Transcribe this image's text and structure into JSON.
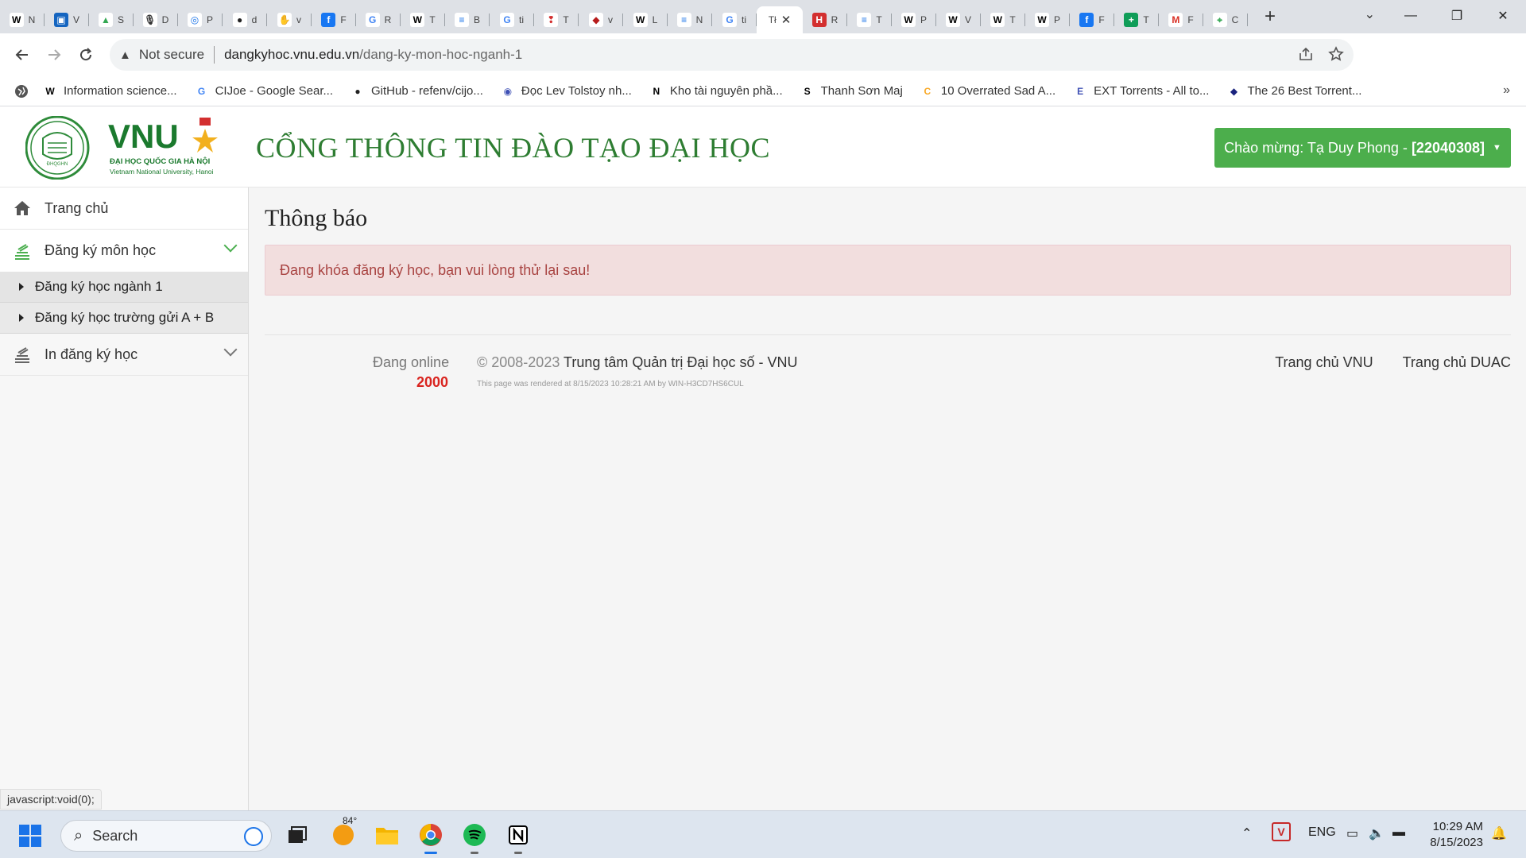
{
  "browser": {
    "tabs": [
      {
        "icon": "wikipedia-icon",
        "glyph": "W",
        "letter": "N",
        "bg": "#ffffff",
        "fg": "#000000"
      },
      {
        "icon": "blue-app-icon",
        "glyph": "▣",
        "letter": "V",
        "bg": "#1565c0",
        "fg": "#ffffff"
      },
      {
        "icon": "google-drive-icon",
        "glyph": "▲",
        "letter": "S",
        "bg": "#ffffff",
        "fg": "#34a853"
      },
      {
        "icon": "microphone-icon",
        "glyph": "🎙",
        "letter": "D",
        "bg": "#ffffff",
        "fg": "#333333"
      },
      {
        "icon": "globe-icon",
        "glyph": "◎",
        "letter": "P",
        "bg": "#ffffff",
        "fg": "#1a73e8"
      },
      {
        "icon": "dark-circle-icon",
        "glyph": "●",
        "letter": "d",
        "bg": "#ffffff",
        "fg": "#222222"
      },
      {
        "icon": "hand-icon",
        "glyph": "✋",
        "letter": "v",
        "bg": "#ffffff",
        "fg": "#e67e22"
      },
      {
        "icon": "facebook-icon",
        "glyph": "f",
        "letter": "F",
        "bg": "#1877f2",
        "fg": "#ffffff"
      },
      {
        "icon": "google-icon",
        "glyph": "G",
        "letter": "R",
        "bg": "#ffffff",
        "fg": "#4285f4"
      },
      {
        "icon": "wikipedia-icon",
        "glyph": "W",
        "letter": "T",
        "bg": "#ffffff",
        "fg": "#000000"
      },
      {
        "icon": "checklist-icon",
        "glyph": "≡",
        "letter": "B",
        "bg": "#ffffff",
        "fg": "#1a73e8"
      },
      {
        "icon": "google-icon",
        "glyph": "G",
        "letter": "ti",
        "bg": "#ffffff",
        "fg": "#4285f4"
      },
      {
        "icon": "pin-icon",
        "glyph": "❢",
        "letter": "T",
        "bg": "#ffffff",
        "fg": "#d32f2f"
      },
      {
        "icon": "diamond-icon",
        "glyph": "◆",
        "letter": "v",
        "bg": "#ffffff",
        "fg": "#b71c1c"
      },
      {
        "icon": "wikipedia-icon",
        "glyph": "W",
        "letter": "L",
        "bg": "#ffffff",
        "fg": "#000000"
      },
      {
        "icon": "checklist-icon",
        "glyph": "≡",
        "letter": "N",
        "bg": "#ffffff",
        "fg": "#1a73e8"
      },
      {
        "icon": "google-icon",
        "glyph": "G",
        "letter": "ti",
        "bg": "#ffffff",
        "fg": "#4285f4"
      }
    ],
    "active_tab": {
      "label": "Tł",
      "close": "✕"
    },
    "tabs_after": [
      {
        "icon": "news-icon",
        "glyph": "H",
        "letter": "R",
        "bg": "#d32f2f",
        "fg": "#ffffff"
      },
      {
        "icon": "checklist-icon",
        "glyph": "≡",
        "letter": "T",
        "bg": "#ffffff",
        "fg": "#1a73e8"
      },
      {
        "icon": "wikipedia-icon",
        "glyph": "W",
        "letter": "P",
        "bg": "#ffffff",
        "fg": "#000000"
      },
      {
        "icon": "wikipedia-icon",
        "glyph": "W",
        "letter": "V",
        "bg": "#ffffff",
        "fg": "#000000"
      },
      {
        "icon": "wikipedia-icon",
        "glyph": "W",
        "letter": "T",
        "bg": "#ffffff",
        "fg": "#000000"
      },
      {
        "icon": "wikipedia-icon",
        "glyph": "W",
        "letter": "P",
        "bg": "#ffffff",
        "fg": "#000000"
      },
      {
        "icon": "facebook-icon",
        "glyph": "f",
        "letter": "F",
        "bg": "#1877f2",
        "fg": "#ffffff"
      },
      {
        "icon": "plus-green-icon",
        "glyph": "+",
        "letter": "T",
        "bg": "#0f9d58",
        "fg": "#ffffff"
      },
      {
        "icon": "gmail-icon",
        "glyph": "M",
        "letter": "F",
        "bg": "#ffffff",
        "fg": "#d93025"
      },
      {
        "icon": "maps-icon",
        "glyph": "⌖",
        "letter": "C",
        "bg": "#ffffff",
        "fg": "#34a853"
      }
    ],
    "new_tab": "+",
    "window_controls": {
      "tab_search": "⌄",
      "minimize": "—",
      "restore": "❐",
      "close": "✕"
    },
    "address": {
      "security_icon": "▲",
      "security_text": "Not secure",
      "domain": "dangkyhoc.vnu.edu.vn",
      "path": "/dang-ky-mon-hoc-nganh-1"
    },
    "bookmarks": [
      {
        "icon": "wikipedia-icon",
        "glyph": "W",
        "label": "Information science...",
        "fg": "#000000"
      },
      {
        "icon": "google-icon",
        "glyph": "G",
        "label": "CIJoe - Google Sear...",
        "fg": "#4285f4"
      },
      {
        "icon": "github-icon",
        "glyph": "●",
        "label": "GitHub - refenv/cijo...",
        "fg": "#222222"
      },
      {
        "icon": "compass-icon",
        "glyph": "◉",
        "label": "Đọc Lev Tolstoy nh...",
        "fg": "#3f51b5"
      },
      {
        "icon": "notion-icon",
        "glyph": "N",
        "label": "Kho tài nguyên phầ...",
        "fg": "#000000"
      },
      {
        "icon": "s-icon",
        "glyph": "S",
        "label": "Thanh Sơn Maj",
        "fg": "#000000"
      },
      {
        "icon": "c-icon",
        "glyph": "C",
        "label": "10 Overrated Sad A...",
        "fg": "#f9a825"
      },
      {
        "icon": "e-icon",
        "glyph": "E",
        "label": "EXT Torrents - All to...",
        "fg": "#3f51b5"
      },
      {
        "icon": "shield-icon",
        "glyph": "◆",
        "label": "The 26 Best Torrent...",
        "fg": "#1a237e"
      }
    ],
    "bookmarks_more": "»",
    "status_url": "javascript:void(0);"
  },
  "site": {
    "logo_text": "VNU",
    "logo_seal_text": "ĐHQGHN",
    "logo_line1": "ĐẠI HỌC QUỐC GIA HÀ NỘI",
    "logo_line2": "Vietnam National University, Hanoi",
    "title": "CỔNG THÔNG TIN ĐÀO TẠO ĐẠI HỌC",
    "welcome_prefix": "Chào mừng: Tạ Duy Phong -",
    "welcome_id": "[22040308]",
    "accent": "#4cae4c"
  },
  "sidebar": {
    "home": "Trang chủ",
    "register": "Đăng ký môn học",
    "register_subitems": [
      "Đăng ký học ngành 1",
      "Đăng ký học trường gửi A + B"
    ],
    "print": "In đăng ký học"
  },
  "main": {
    "heading": "Thông báo",
    "alert": "Đang khóa đăng ký học, bạn vui lòng thử lại sau!"
  },
  "footer": {
    "online_label": "Đang online",
    "online_count": "2000",
    "copyright_prefix": "© 2008-2023",
    "copyright_org": "Trung tâm Quản trị Đại học số - VNU",
    "rendered": "This page was rendered at 8/15/2023 10:28:21 AM by WIN-H3CD7HS6CUL",
    "links": [
      "Trang chủ VNU",
      "Trang chủ DUAC"
    ]
  },
  "taskbar": {
    "search_placeholder": "Search",
    "weather": "84°",
    "language": "ENG",
    "time": "10:29 AM",
    "date": "8/15/2023"
  }
}
